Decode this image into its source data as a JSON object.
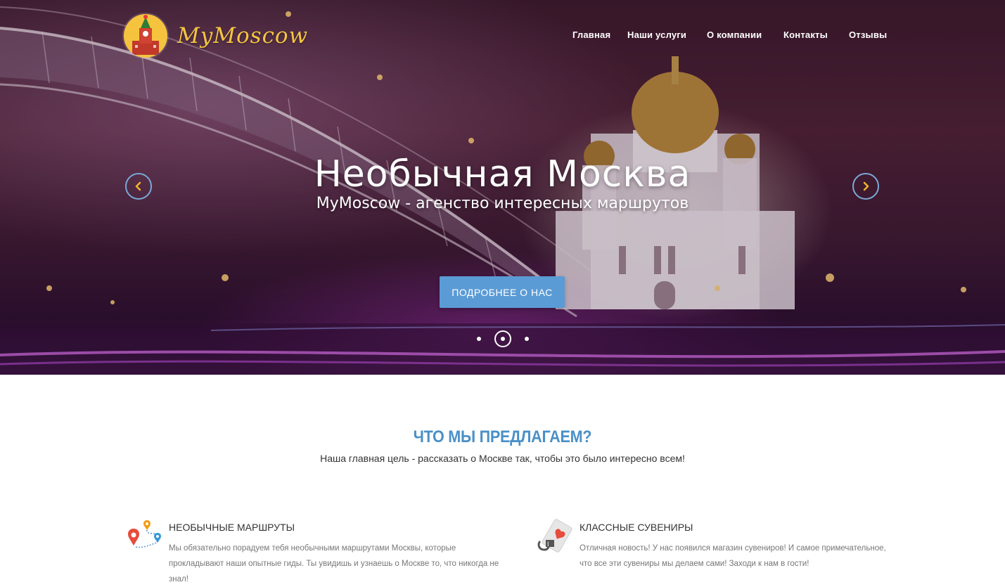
{
  "header": {
    "logo_text": "MyMoscow",
    "nav": [
      "Главная",
      "Наши услуги",
      "О компании",
      "Контакты",
      "Отзывы"
    ]
  },
  "hero": {
    "title": "Необычная Москва",
    "subtitle": "MyMoscow - агенство интересных маршрутов",
    "button_label": "ПОДРОБНЕЕ О НАС",
    "slides_count": 3,
    "active_slide": 2
  },
  "offers": {
    "title": "ЧТО МЫ ПРЕДЛАГАЕМ?",
    "subtitle": "Наша главная цель - рассказать о Москве так, чтобы это было интересно всем!",
    "features": [
      {
        "icon": "route-pins-icon",
        "title": "НЕОБЫЧНЫЕ МАРШРУТЫ",
        "text": "Мы обязательно порадуем тебя необычными маршрутами Москвы, которые прокладывают наши опытные гиды. Ты увидишь и узнаешь о Москве то, что никогда не знал!"
      },
      {
        "icon": "souvenir-tag-icon",
        "title": "КЛАССНЫЕ СУВЕНИРЫ",
        "text": "Отличная новость! У нас появился магазин сувениров! И самое примечательное, что все эти сувениры мы делаем сами! Заходи к нам в гости!"
      }
    ]
  },
  "colors": {
    "accent_blue": "#5b9bd5",
    "logo_yellow": "#f4c542",
    "arrow_chevron": "#f0b429"
  }
}
